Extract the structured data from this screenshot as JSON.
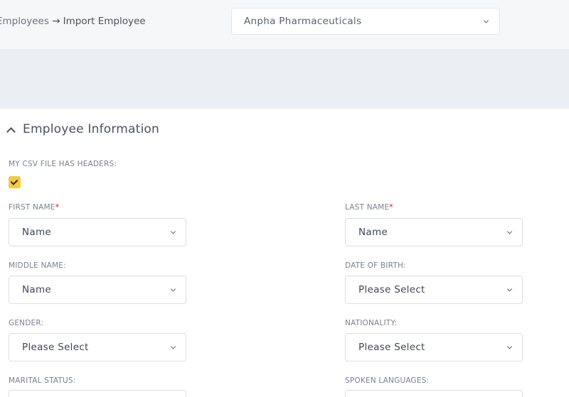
{
  "header": {
    "breadcrumb": {
      "parent": "Employees",
      "arrow": "→",
      "current": "Import Employee"
    },
    "company_select": {
      "value": "Anpha Pharmaceuticals"
    }
  },
  "section": {
    "title": "Employee Information",
    "csv_headers_label": "MY CSV FILE HAS HEADERS:",
    "csv_headers_checked": true
  },
  "fields": {
    "first_name": {
      "label": "FIRST NAME",
      "required_mark": "*",
      "value": "Name"
    },
    "last_name": {
      "label": "LAST NAME",
      "required_mark": "*",
      "value": "Name"
    },
    "middle_name": {
      "label": "MIDDLE NAME:",
      "value": "Name"
    },
    "date_of_birth": {
      "label": "DATE OF BIRTH:",
      "value": "Please Select"
    },
    "gender": {
      "label": "GENDER:",
      "value": "Please Select"
    },
    "nationality": {
      "label": "NATIONALITY:",
      "value": "Please Select"
    },
    "marital_status": {
      "label": "MARITAL STATUS:"
    },
    "spoken_languages": {
      "label": "SPOKEN LANGUAGES:"
    }
  },
  "colors": {
    "checkbox_accent": "#f7c93d",
    "required": "#d0021b",
    "band": "#ebeef3"
  }
}
